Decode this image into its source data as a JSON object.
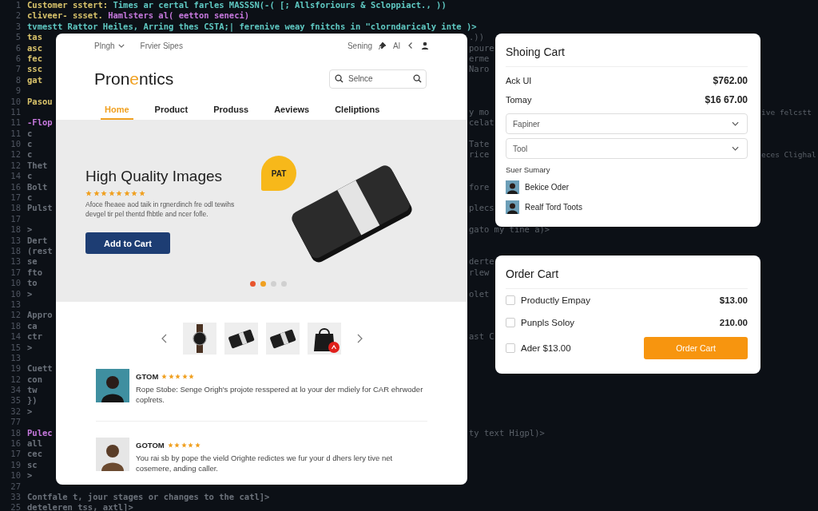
{
  "code_editor": {
    "lines": [
      {
        "number": "1",
        "kind": "full",
        "segments": [
          {
            "text": "Customer sstert:",
            "color": "#d9c36b"
          },
          {
            "text": " Times ar certal farles MASSSN(-( [; Allsforiours & Scloppiact., ))",
            "color": "#5fc8c2"
          }
        ]
      },
      {
        "number": "2",
        "kind": "full",
        "segments": [
          {
            "text": "cliveer- ssset.",
            "color": "#d9c36b"
          },
          {
            "text": " Hamlsters al( eetton seneci)",
            "color": "#c678dd"
          }
        ]
      },
      {
        "number": "3",
        "kind": "full",
        "segments": [
          {
            "text": "tvmestt Rattor Heiles, Arring thes CSTA;| ferenive weay fnitchs in \"clorndaricaly inte )>",
            "color": "#5fc8c2"
          }
        ]
      },
      {
        "number": "5",
        "kind": "split",
        "left": "tas",
        "color": "#d9c36b",
        "mid": ".))"
      },
      {
        "number": "6",
        "kind": "split",
        "left": "asc",
        "color": "#d9c36b",
        "mid": "poure"
      },
      {
        "number": "6",
        "kind": "split",
        "left": "fec",
        "color": "#d9c36b",
        "mid": "erme"
      },
      {
        "number": "7",
        "kind": "split",
        "left": "ssc",
        "color": "#d9c36b",
        "mid": "Naro"
      },
      {
        "number": "8",
        "kind": "split",
        "left": "gat",
        "color": "#d9c36b"
      },
      {
        "number": "9",
        "kind": "split"
      },
      {
        "number": "10",
        "kind": "split",
        "left": "Pasou",
        "color": "#d9c36b"
      },
      {
        "number": "11",
        "kind": "split",
        "mid": "y mo",
        "right": "ive felcstt"
      },
      {
        "number": "11",
        "kind": "split",
        "left": "-Flop",
        "color": "#c678dd",
        "mid": "celat"
      },
      {
        "number": "11",
        "kind": "split",
        "left": "c",
        "color": "#6b717a"
      },
      {
        "number": "10",
        "kind": "split",
        "left": "c",
        "color": "#6b717a",
        "mid": "Tate"
      },
      {
        "number": "12",
        "kind": "split",
        "left": "c",
        "color": "#6b717a",
        "mid": "rice",
        "right": "eces Clighal"
      },
      {
        "number": "12",
        "kind": "split",
        "left": "Thet",
        "color": "#6b717a"
      },
      {
        "number": "14",
        "kind": "split",
        "left": "c",
        "color": "#6b717a"
      },
      {
        "number": "16",
        "kind": "split",
        "left": "Bolt",
        "color": "#6b717a",
        "mid": "fore"
      },
      {
        "number": "17",
        "kind": "split",
        "left": "c",
        "color": "#6b717a"
      },
      {
        "number": "18",
        "kind": "split",
        "left": "Pulst",
        "color": "#6b717a",
        "mid": "plecs"
      },
      {
        "number": "17",
        "kind": "split"
      },
      {
        "number": "18",
        "kind": "split",
        "left": ">",
        "color": "#6b717a",
        "mid": "gato my tine a)>"
      },
      {
        "number": "13",
        "kind": "split",
        "left": "Dert",
        "color": "#6b717a"
      },
      {
        "number": "18",
        "kind": "split",
        "left": "(rest",
        "color": "#6b717a"
      },
      {
        "number": "13",
        "kind": "split",
        "left": "se",
        "color": "#6b717a",
        "mid": "derte"
      },
      {
        "number": "17",
        "kind": "split",
        "left": "fto",
        "color": "#6b717a",
        "mid": "rlew"
      },
      {
        "number": "10",
        "kind": "split",
        "left": "to",
        "color": "#6b717a"
      },
      {
        "number": "10",
        "kind": "split",
        "left": ">",
        "color": "#6b717a",
        "mid": "olet"
      },
      {
        "number": "13",
        "kind": "split"
      },
      {
        "number": "12",
        "kind": "split",
        "left": "Appro",
        "color": "#6b717a"
      },
      {
        "number": "18",
        "kind": "split",
        "left": "ca",
        "color": "#6b717a"
      },
      {
        "number": "14",
        "kind": "split",
        "left": "ctr",
        "color": "#6b717a",
        "mid": "ast C"
      },
      {
        "number": "15",
        "kind": "split",
        "left": ">",
        "color": "#6b717a"
      },
      {
        "number": "13",
        "kind": "split"
      },
      {
        "number": "19",
        "kind": "split",
        "left": "Cuett",
        "color": "#6b717a"
      },
      {
        "number": "12",
        "kind": "split",
        "left": "con",
        "color": "#6b717a"
      },
      {
        "number": "34",
        "kind": "split",
        "left": "tw",
        "color": "#6b717a"
      },
      {
        "number": "35",
        "kind": "split",
        "left": "})",
        "color": "#6b717a"
      },
      {
        "number": "32",
        "kind": "split",
        "left": ">",
        "color": "#6b717a"
      },
      {
        "number": "77",
        "kind": "split"
      },
      {
        "number": "18",
        "kind": "split",
        "left": "Pulec",
        "color": "#c678dd",
        "mid": "ty text Higpl)>"
      },
      {
        "number": "16",
        "kind": "split",
        "left": "all",
        "color": "#6b717a"
      },
      {
        "number": "17",
        "kind": "split",
        "left": "cec",
        "color": "#6b717a"
      },
      {
        "number": "19",
        "kind": "split",
        "left": "sc",
        "color": "#6b717a"
      },
      {
        "number": "10",
        "kind": "split",
        "left": ">",
        "color": "#6b717a"
      },
      {
        "number": "27",
        "kind": "split"
      },
      {
        "number": "33",
        "kind": "full",
        "segments": [
          {
            "text": "Contfale t, jour stages or changes to the catl]>",
            "color": "#6b717a"
          }
        ]
      },
      {
        "number": "25",
        "kind": "full",
        "segments": [
          {
            "text": "deteleren tss, axtl]>",
            "color": "#6b717a"
          }
        ]
      }
    ]
  },
  "store": {
    "top_bar": {
      "menu": "Plngh",
      "link": "Frvier Sipes",
      "setting": "Sening",
      "pin_label": "Al"
    },
    "logo": {
      "before": "Pron",
      "accent": "e",
      "after": "ntics"
    },
    "search": {
      "placeholder": "Selnce"
    },
    "tabs": [
      {
        "label": "Home",
        "selected": true
      },
      {
        "label": "Product",
        "selected": false
      },
      {
        "label": "Produss",
        "selected": false
      },
      {
        "label": "Aeviews",
        "selected": false
      },
      {
        "label": "Cleliptions",
        "selected": false
      }
    ],
    "hero": {
      "title": "High Quality Images",
      "stars": 8,
      "description": "Afoce fheaee aod taik in rgnerdinch fre odl tewihs devgel tir pel thentd fhbtle and ncer fofle.",
      "button": "Add to Cart",
      "badge": "PAT",
      "dots": [
        {
          "color": "#e8552d"
        },
        {
          "color": "#f0a020"
        },
        {
          "color": "#d0d0d0"
        },
        {
          "color": "#d0d0d0"
        }
      ]
    },
    "thumbnails": [
      {
        "kind": "watch",
        "badge": false
      },
      {
        "kind": "device",
        "badge": false
      },
      {
        "kind": "device",
        "badge": false
      },
      {
        "kind": "bag",
        "badge": true
      }
    ],
    "reviews": [
      {
        "name": "GTOM",
        "stars": 5,
        "text": "Rope Stobe: Senge Origh's projote resspered at lo your der rndiely for CAR ehrwoder coplrets."
      },
      {
        "name": "GOTOM",
        "stars": 5,
        "text": "You rai sb by pope the vield Orighte redictes we fur your d dhers lery tive net cosemere, anding caller."
      }
    ]
  },
  "shopping_cart": {
    "title": "Shoing Cart",
    "rows": [
      {
        "label": "Ack UI",
        "price": "$762.00"
      },
      {
        "label": "Tomay",
        "price": "$16 67.00"
      }
    ],
    "selects": [
      {
        "value": "Fapiner"
      },
      {
        "value": "Tool"
      }
    ],
    "summary_title": "Suer Sumary",
    "summary_items": [
      {
        "name": "Bekice Oder"
      },
      {
        "name": "Realf Tord Toots"
      }
    ]
  },
  "order_cart": {
    "title": "Order Cart",
    "items": [
      {
        "label": "Productly Empay",
        "price": "$13.00",
        "checked": false
      },
      {
        "label": "Punpls Soloy",
        "price": "210.00",
        "checked": false
      },
      {
        "label": "Ader $13.00",
        "checked": false
      }
    ],
    "button": "Order Cart"
  }
}
